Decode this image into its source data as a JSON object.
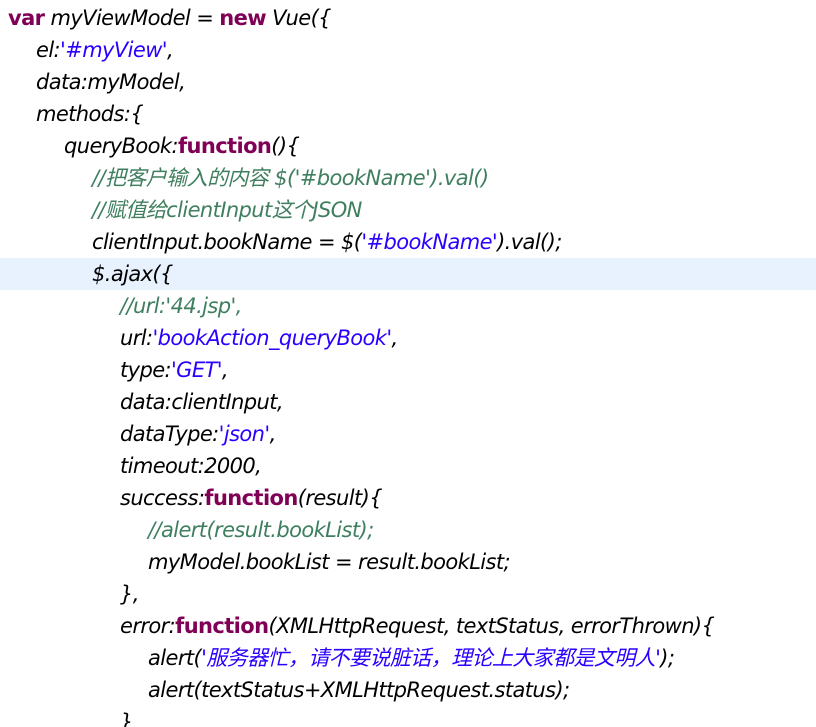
{
  "editor": {
    "colors": {
      "keyword": "#7f0055",
      "string": "#2a00ff",
      "comment": "#3f7f5f",
      "text": "#000000",
      "current_line": "#e8f2fe"
    },
    "current_line_index": 8,
    "lines": [
      {
        "indent": 0,
        "tokens": [
          [
            "kw",
            "var"
          ],
          [
            "plain",
            " myViewModel = "
          ],
          [
            "kw",
            "new"
          ],
          [
            "plain",
            " Vue({"
          ]
        ]
      },
      {
        "indent": 1,
        "tokens": [
          [
            "plain",
            "el:"
          ],
          [
            "str",
            "'#myView'"
          ],
          [
            "plain",
            ","
          ]
        ]
      },
      {
        "indent": 1,
        "tokens": [
          [
            "plain",
            "data:myModel,"
          ]
        ]
      },
      {
        "indent": 1,
        "tokens": [
          [
            "plain",
            "methods:{"
          ]
        ]
      },
      {
        "indent": 2,
        "tokens": [
          [
            "plain",
            "queryBook:"
          ],
          [
            "kw",
            "function"
          ],
          [
            "plain",
            "(){"
          ]
        ]
      },
      {
        "indent": 3,
        "tokens": [
          [
            "cmt",
            "//把客户输入的内容 $('#bookName').val()"
          ]
        ]
      },
      {
        "indent": 3,
        "tokens": [
          [
            "cmt",
            "//赋值给clientInput这个JSON"
          ]
        ]
      },
      {
        "indent": 3,
        "tokens": [
          [
            "plain",
            "clientInput.bookName = $("
          ],
          [
            "str",
            "'#bookName'"
          ],
          [
            "plain",
            ").val();"
          ]
        ]
      },
      {
        "indent": 3,
        "tokens": [
          [
            "plain",
            "$.ajax({"
          ]
        ]
      },
      {
        "indent": 4,
        "tokens": [
          [
            "cmt",
            "//url:'44.jsp',"
          ]
        ]
      },
      {
        "indent": 4,
        "tokens": [
          [
            "plain",
            "url:"
          ],
          [
            "str",
            "'bookAction_queryBook'"
          ],
          [
            "plain",
            ","
          ]
        ]
      },
      {
        "indent": 4,
        "tokens": [
          [
            "plain",
            "type:"
          ],
          [
            "str",
            "'GET'"
          ],
          [
            "plain",
            ","
          ]
        ]
      },
      {
        "indent": 4,
        "tokens": [
          [
            "plain",
            "data:clientInput,"
          ]
        ]
      },
      {
        "indent": 4,
        "tokens": [
          [
            "plain",
            "dataType:"
          ],
          [
            "str",
            "'json'"
          ],
          [
            "plain",
            ","
          ]
        ]
      },
      {
        "indent": 4,
        "tokens": [
          [
            "plain",
            "timeout:2000,"
          ]
        ]
      },
      {
        "indent": 4,
        "tokens": [
          [
            "plain",
            "success:"
          ],
          [
            "kw",
            "function"
          ],
          [
            "plain",
            "(result){"
          ]
        ]
      },
      {
        "indent": 5,
        "tokens": [
          [
            "cmt",
            "//alert(result.bookList);"
          ]
        ]
      },
      {
        "indent": 5,
        "tokens": [
          [
            "plain",
            "myModel.bookList = result.bookList;"
          ]
        ]
      },
      {
        "indent": 4,
        "tokens": [
          [
            "plain",
            "},"
          ]
        ]
      },
      {
        "indent": 4,
        "tokens": [
          [
            "plain",
            "error:"
          ],
          [
            "kw",
            "function"
          ],
          [
            "plain",
            "(XMLHttpRequest, textStatus, errorThrown){"
          ]
        ]
      },
      {
        "indent": 5,
        "tokens": [
          [
            "plain",
            "alert("
          ],
          [
            "str",
            "'服务器忙，请不要说脏话，理论上大家都是文明人'"
          ],
          [
            "plain",
            ");"
          ]
        ]
      },
      {
        "indent": 5,
        "tokens": [
          [
            "plain",
            "alert(textStatus+XMLHttpRequest.status);"
          ]
        ]
      },
      {
        "indent": 4,
        "tokens": [
          [
            "plain",
            "}"
          ]
        ]
      }
    ]
  }
}
